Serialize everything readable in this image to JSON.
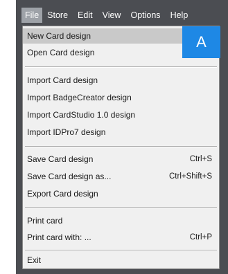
{
  "menubar": {
    "items": [
      "File",
      "Store",
      "Edit",
      "View",
      "Options",
      "Help"
    ]
  },
  "file_menu": {
    "items": [
      {
        "label": "New Card design",
        "shortcut": ""
      },
      {
        "label": "Open Card design",
        "shortcut": ""
      },
      {
        "label": "Import Card design",
        "shortcut": ""
      },
      {
        "label": "Import BadgeCreator design",
        "shortcut": ""
      },
      {
        "label": "Import CardStudio 1.0 design",
        "shortcut": ""
      },
      {
        "label": "Import IDPro7 design",
        "shortcut": ""
      },
      {
        "label": "Save Card design",
        "shortcut": "Ctrl+S"
      },
      {
        "label": "Save Card design as...",
        "shortcut": "Ctrl+Shift+S"
      },
      {
        "label": "Export Card design",
        "shortcut": ""
      },
      {
        "label": "Print card",
        "shortcut": ""
      },
      {
        "label": "Print card with: ...",
        "shortcut": "Ctrl+P"
      },
      {
        "label": "Exit",
        "shortcut": ""
      }
    ]
  },
  "callout": {
    "label": "A",
    "color": "#1e88e5"
  }
}
